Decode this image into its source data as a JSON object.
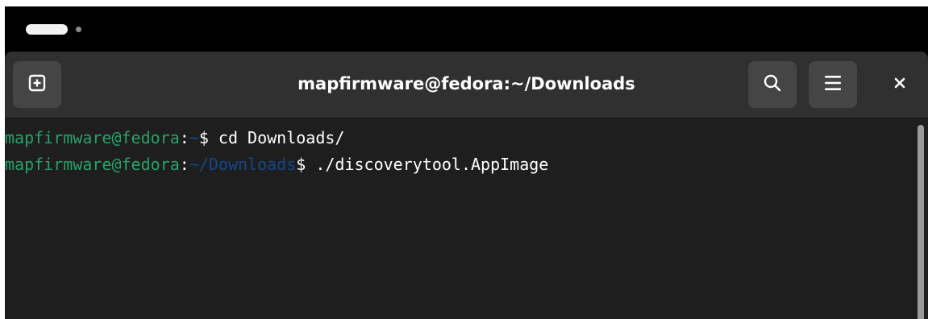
{
  "window": {
    "title": "mapfirmware@fedora:~/Downloads"
  },
  "headerbar": {
    "new_tab_icon": "new-tab-icon",
    "search_icon": "search-icon",
    "menu_icon": "hamburger-menu-icon",
    "close_icon": "close-icon"
  },
  "terminal": {
    "lines": [
      {
        "user_host": "mapfirmware@fedora",
        "colon": ":",
        "path": "~",
        "prompt": "$",
        "command": " cd Downloads/"
      },
      {
        "user_host": "mapfirmware@fedora",
        "colon": ":",
        "path": "~/Downloads",
        "prompt": "$",
        "command": " ./discoverytool.AppImage"
      }
    ]
  },
  "colors": {
    "user_host": "#26a269",
    "path": "#12488b",
    "terminal_bg": "#1e1e1e",
    "headerbar_bg": "#303030"
  }
}
